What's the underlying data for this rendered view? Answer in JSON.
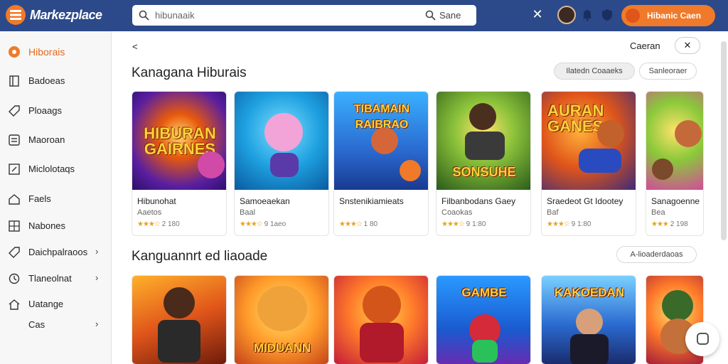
{
  "app": {
    "brand": "Markezplace"
  },
  "search": {
    "query": "hibunaaik",
    "button_label": "Sane"
  },
  "header": {
    "cta_label": "Hibanic Caen"
  },
  "sidebar": {
    "items": [
      {
        "label": "Hiborais",
        "icon": "orange-dot-icon"
      },
      {
        "label": "Badoeas",
        "icon": "book-icon"
      },
      {
        "label": "Ploaags",
        "icon": "tag-icon"
      },
      {
        "label": "Maoroan",
        "icon": "list-icon"
      },
      {
        "label": "Miclolotaqs",
        "icon": "edit-icon"
      },
      {
        "label": "Faels",
        "icon": "home-icon"
      },
      {
        "label": "Nabones",
        "icon": "grid-icon"
      },
      {
        "label": "Daichpalraoos",
        "icon": "tag-icon"
      },
      {
        "label": "Tlaneolnat",
        "icon": "clock-icon"
      },
      {
        "label": "Uatange",
        "icon": "house-icon"
      },
      {
        "label": "Cas",
        "icon": ""
      }
    ]
  },
  "main": {
    "back": "<",
    "sort_label": "Caeran",
    "sort_button": "✕",
    "section1": {
      "title": "Kanagana Hiburais",
      "filter_a": "Ilatedn Coaaeks",
      "filter_b": "Sanleoraer",
      "cards": [
        {
          "thumb_title": "HIBURAN GAIRNES",
          "name": "Hibunohat",
          "sub": "Aaetos",
          "rating_num": "2 180"
        },
        {
          "thumb_title": "",
          "name": "Samoeaekan",
          "sub": "Baal",
          "rating_num": "9 1aeo"
        },
        {
          "thumb_title": "TIBAMAIN RAIBRAO",
          "name": "Snstenikiamieats",
          "sub": "",
          "rating_num": "1 80"
        },
        {
          "thumb_title": "SONSUHE",
          "name": "Filbanbodans Gaey",
          "sub": "Coaokas",
          "rating_num": "9 1:80"
        },
        {
          "thumb_title": "AURAN GANES",
          "name": "Sraedeot Gt Idootey",
          "sub": "Baf",
          "rating_num": "9 1:80"
        },
        {
          "thumb_title": "",
          "name": "Sanagoenne",
          "sub": "Bea",
          "rating_num": "2 198"
        }
      ]
    },
    "section2": {
      "title": "Kanguannrt ed liaoade",
      "filter": "A-lioaderdaoas",
      "cards": [
        {
          "thumb_title": ""
        },
        {
          "thumb_title": "MIDUANN"
        },
        {
          "thumb_title": ""
        },
        {
          "thumb_title": "GAMBE"
        },
        {
          "thumb_title": "KAKOEDAN"
        },
        {
          "thumb_title": ""
        }
      ]
    }
  },
  "colors": {
    "topbar": "#2c4a8a",
    "accent": "#f07a2a",
    "star": "#e8a21c"
  }
}
